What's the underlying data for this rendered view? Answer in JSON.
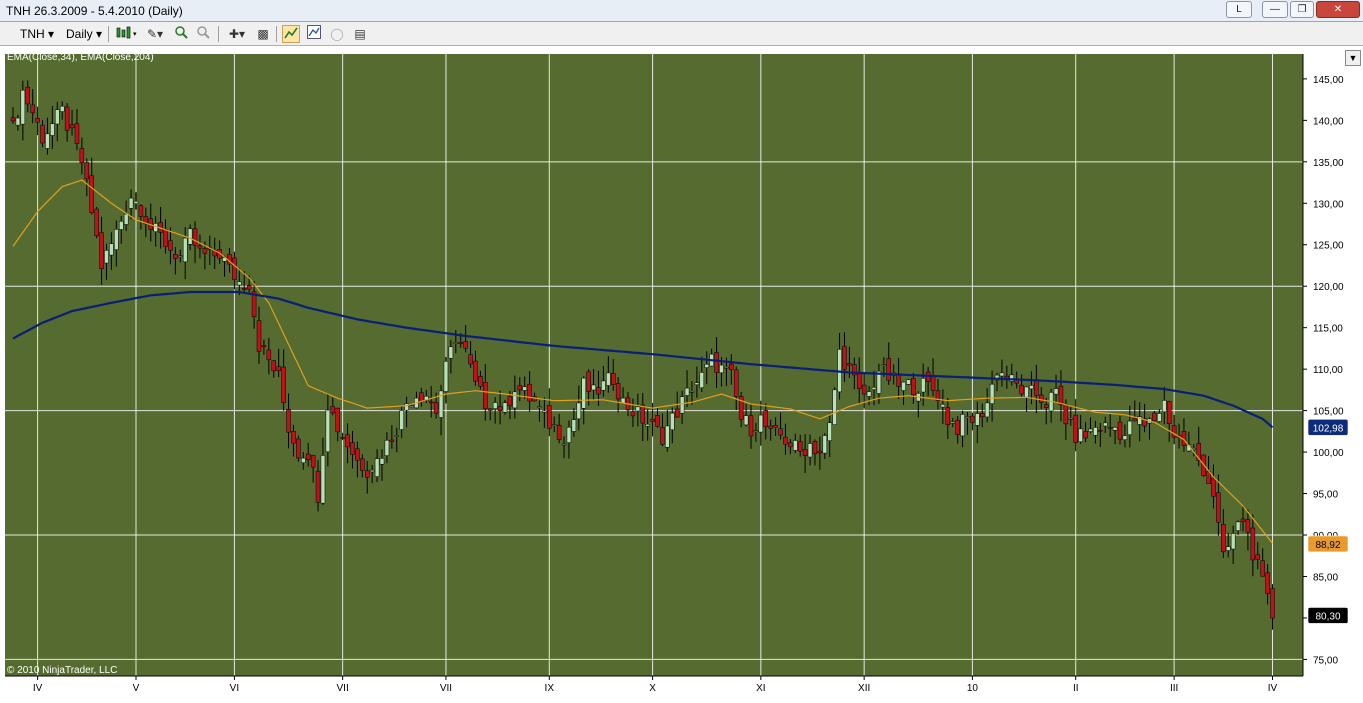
{
  "window": {
    "title": "TNH  26.3.2009 - 5.4.2010 (Daily)",
    "btn_l": "L",
    "btn_min": "—",
    "btn_max": "❐",
    "btn_close": "✕"
  },
  "toolbar": {
    "instrument": "TNH",
    "period": "Daily",
    "icons": [
      "candlestick-icon",
      "pencil-icon",
      "zoom-in-icon",
      "zoom-out-icon",
      "crosshair-icon",
      "properties-icon",
      "strategy-icon",
      "indicator-icon",
      "globe-icon",
      "data-box-icon"
    ]
  },
  "chart": {
    "indicator_label": "EMA(Close,34), EMA(Close,204)",
    "copyright": "© 2010 NinjaTrader, LLC",
    "price_badges": [
      {
        "label": "102,98",
        "value": 102.98,
        "bg": "#0d2b7a",
        "fg": "#ffffff"
      },
      {
        "label": "88,92",
        "value": 88.92,
        "bg": "#e89b2a",
        "fg": "#000000"
      },
      {
        "label": "80,30",
        "value": 80.3,
        "bg": "#000000",
        "fg": "#ffffff"
      }
    ],
    "colors": {
      "background": "#556b2f",
      "up_candle": "#b8e0b8",
      "down_candle": "#c0101c",
      "wick": "#000000",
      "ema_fast": "#e0a020",
      "ema_slow": "#0a1e78",
      "grid": "#ffffff"
    }
  },
  "chart_data": {
    "type": "candlestick",
    "title": "TNH  26.3.2009 - 5.4.2010 (Daily)",
    "ylim": [
      73,
      148
    ],
    "y_ticks": [
      "145,00",
      "140,00",
      "135,00",
      "130,00",
      "125,00",
      "120,00",
      "115,00",
      "110,00",
      "105,00",
      "100,00",
      "95,00",
      "90,00",
      "85,00",
      "80,00",
      "75,00"
    ],
    "y_tick_values": [
      145,
      140,
      135,
      130,
      125,
      120,
      115,
      110,
      105,
      100,
      95,
      90,
      85,
      80,
      75
    ],
    "x_ticks": [
      "IV",
      "V",
      "VI",
      "VII",
      "VII",
      "IX",
      "X",
      "XI",
      "XII",
      "10",
      "II",
      "III",
      "IV"
    ],
    "x_tick_index": [
      5,
      25,
      45,
      67,
      88,
      109,
      130,
      152,
      173,
      195,
      216,
      236,
      256
    ],
    "bar_count": 258,
    "ema34_points": [
      [
        0,
        124.8
      ],
      [
        5,
        129
      ],
      [
        10,
        132
      ],
      [
        14,
        132.8
      ],
      [
        20,
        130
      ],
      [
        25,
        128
      ],
      [
        30,
        127
      ],
      [
        36,
        125.8
      ],
      [
        42,
        124
      ],
      [
        48,
        121
      ],
      [
        52,
        118
      ],
      [
        56,
        113
      ],
      [
        60,
        108
      ],
      [
        66,
        106.5
      ],
      [
        72,
        105.3
      ],
      [
        80,
        105.6
      ],
      [
        88,
        107
      ],
      [
        94,
        107.4
      ],
      [
        100,
        107
      ],
      [
        110,
        106.2
      ],
      [
        120,
        106.3
      ],
      [
        130,
        105.3
      ],
      [
        138,
        106
      ],
      [
        144,
        107
      ],
      [
        150,
        105.8
      ],
      [
        158,
        105.2
      ],
      [
        164,
        104
      ],
      [
        170,
        105.5
      ],
      [
        176,
        106.5
      ],
      [
        182,
        106.8
      ],
      [
        190,
        106.2
      ],
      [
        198,
        106.5
      ],
      [
        206,
        106.6
      ],
      [
        212,
        106
      ],
      [
        220,
        104.8
      ],
      [
        226,
        104.5
      ],
      [
        232,
        103.6
      ],
      [
        238,
        101.5
      ],
      [
        244,
        97
      ],
      [
        250,
        93.5
      ],
      [
        256,
        89
      ]
    ],
    "ema204_points": [
      [
        0,
        113.7
      ],
      [
        6,
        115.6
      ],
      [
        12,
        117
      ],
      [
        20,
        118
      ],
      [
        28,
        118.9
      ],
      [
        36,
        119.3
      ],
      [
        46,
        119.3
      ],
      [
        54,
        118.5
      ],
      [
        60,
        117.4
      ],
      [
        70,
        116
      ],
      [
        80,
        115
      ],
      [
        92,
        114
      ],
      [
        110,
        112.8
      ],
      [
        130,
        111.8
      ],
      [
        150,
        110.6
      ],
      [
        170,
        109.6
      ],
      [
        190,
        109.1
      ],
      [
        210,
        108.6
      ],
      [
        224,
        108.1
      ],
      [
        234,
        107.6
      ],
      [
        242,
        106.8
      ],
      [
        248,
        105.6
      ],
      [
        254,
        104
      ],
      [
        256,
        102.98
      ]
    ],
    "close_anchors": [
      [
        0,
        139
      ],
      [
        2,
        143.5
      ],
      [
        4,
        141
      ],
      [
        6,
        138
      ],
      [
        8,
        139.5
      ],
      [
        10,
        141
      ],
      [
        12,
        138
      ],
      [
        14,
        135
      ],
      [
        16,
        129
      ],
      [
        18,
        122.5
      ],
      [
        20,
        125
      ],
      [
        22,
        128
      ],
      [
        24,
        131
      ],
      [
        26,
        129.5
      ],
      [
        28,
        127
      ],
      [
        30,
        126
      ],
      [
        32,
        124.5
      ],
      [
        34,
        123.5
      ],
      [
        36,
        126
      ],
      [
        38,
        124
      ],
      [
        40,
        123.5
      ],
      [
        42,
        124
      ],
      [
        44,
        122
      ],
      [
        46,
        120.5
      ],
      [
        48,
        120.5
      ],
      [
        50,
        113
      ],
      [
        52,
        111
      ],
      [
        54,
        109
      ],
      [
        56,
        103
      ],
      [
        58,
        100
      ],
      [
        60,
        100
      ],
      [
        62,
        95
      ],
      [
        64,
        106
      ],
      [
        66,
        103
      ],
      [
        68,
        101
      ],
      [
        70,
        99
      ],
      [
        72,
        98
      ],
      [
        74,
        99
      ],
      [
        76,
        101
      ],
      [
        78,
        103
      ],
      [
        80,
        106
      ],
      [
        82,
        107
      ],
      [
        84,
        107
      ],
      [
        86,
        105
      ],
      [
        88,
        110
      ],
      [
        90,
        114
      ],
      [
        92,
        112
      ],
      [
        94,
        108
      ],
      [
        96,
        106
      ],
      [
        98,
        106
      ],
      [
        100,
        105
      ],
      [
        102,
        108
      ],
      [
        104,
        107
      ],
      [
        106,
        106
      ],
      [
        108,
        104
      ],
      [
        110,
        103
      ],
      [
        112,
        102
      ],
      [
        114,
        104
      ],
      [
        116,
        108
      ],
      [
        118,
        107
      ],
      [
        120,
        108
      ],
      [
        122,
        109
      ],
      [
        124,
        106
      ],
      [
        126,
        105
      ],
      [
        128,
        104
      ],
      [
        130,
        103
      ],
      [
        132,
        102
      ],
      [
        134,
        104
      ],
      [
        136,
        106
      ],
      [
        138,
        108
      ],
      [
        140,
        109
      ],
      [
        142,
        111
      ],
      [
        144,
        110
      ],
      [
        146,
        109
      ],
      [
        148,
        104
      ],
      [
        150,
        103
      ],
      [
        152,
        104
      ],
      [
        154,
        102
      ],
      [
        156,
        102
      ],
      [
        158,
        101
      ],
      [
        160,
        100
      ],
      [
        162,
        101
      ],
      [
        164,
        100
      ],
      [
        166,
        103
      ],
      [
        168,
        112
      ],
      [
        170,
        110
      ],
      [
        172,
        107
      ],
      [
        174,
        107
      ],
      [
        176,
        110
      ],
      [
        178,
        109
      ],
      [
        180,
        108
      ],
      [
        182,
        108
      ],
      [
        184,
        108
      ],
      [
        186,
        108
      ],
      [
        188,
        107
      ],
      [
        190,
        104
      ],
      [
        192,
        103
      ],
      [
        194,
        104
      ],
      [
        196,
        104
      ],
      [
        198,
        106
      ],
      [
        200,
        110
      ],
      [
        202,
        109
      ],
      [
        204,
        108
      ],
      [
        206,
        107
      ],
      [
        208,
        107
      ],
      [
        210,
        106
      ],
      [
        212,
        107
      ],
      [
        214,
        104
      ],
      [
        216,
        102
      ],
      [
        218,
        102
      ],
      [
        220,
        103
      ],
      [
        222,
        103
      ],
      [
        224,
        103
      ],
      [
        226,
        102
      ],
      [
        228,
        104
      ],
      [
        230,
        103
      ],
      [
        232,
        104
      ],
      [
        234,
        106
      ],
      [
        236,
        102
      ],
      [
        238,
        101
      ],
      [
        240,
        100
      ],
      [
        242,
        98
      ],
      [
        244,
        95
      ],
      [
        246,
        87
      ],
      [
        248,
        90
      ],
      [
        250,
        92
      ],
      [
        252,
        88
      ],
      [
        254,
        84
      ],
      [
        256,
        80.3
      ]
    ],
    "price_labels": {
      "ema204": "102,98",
      "ema34": "88,92",
      "close": "80,30"
    }
  }
}
